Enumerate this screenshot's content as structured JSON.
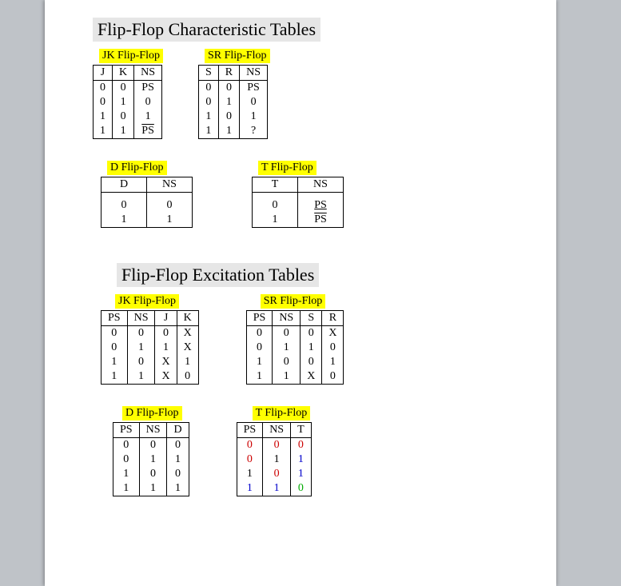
{
  "characteristic": {
    "title": "Flip-Flop Characteristic Tables",
    "jk": {
      "label": "JK Flip-Flop",
      "h": {
        "c0": "J",
        "c1": "K",
        "c2": "NS"
      },
      "r": [
        {
          "c0": "0",
          "c1": "0",
          "c2": "PS"
        },
        {
          "c0": "0",
          "c1": "1",
          "c2": "0"
        },
        {
          "c0": "1",
          "c1": "0",
          "c2": "1"
        },
        {
          "c0": "1",
          "c1": "1",
          "c2": "PS"
        }
      ]
    },
    "sr": {
      "label": "SR Flip-Flop",
      "h": {
        "c0": "S",
        "c1": "R",
        "c2": "NS"
      },
      "r": [
        {
          "c0": "0",
          "c1": "0",
          "c2": "PS"
        },
        {
          "c0": "0",
          "c1": "1",
          "c2": "0"
        },
        {
          "c0": "1",
          "c1": "0",
          "c2": "1"
        },
        {
          "c0": "1",
          "c1": "1",
          "c2": "?"
        }
      ]
    },
    "d": {
      "label": "D Flip-Flop",
      "h": {
        "c0": "D",
        "c1": "NS"
      },
      "r": [
        {
          "c0": "0",
          "c1": "0"
        },
        {
          "c0": "1",
          "c1": "1"
        }
      ]
    },
    "t": {
      "label": "T Flip-Flop",
      "h": {
        "c0": "T",
        "c1": "NS"
      },
      "r": [
        {
          "c0": "0",
          "c1": "PS"
        },
        {
          "c0": "1",
          "c1": "PS"
        }
      ]
    }
  },
  "excitation": {
    "title": "Flip-Flop Excitation Tables",
    "jk": {
      "label": "JK Flip-Flop",
      "h": {
        "c0": "PS",
        "c1": "NS",
        "c2": "J",
        "c3": "K"
      },
      "r": [
        {
          "c0": "0",
          "c1": "0",
          "c2": "0",
          "c3": "X"
        },
        {
          "c0": "0",
          "c1": "1",
          "c2": "1",
          "c3": "X"
        },
        {
          "c0": "1",
          "c1": "0",
          "c2": "X",
          "c3": "1"
        },
        {
          "c0": "1",
          "c1": "1",
          "c2": "X",
          "c3": "0"
        }
      ]
    },
    "sr": {
      "label": "SR Flip-Flop",
      "h": {
        "c0": "PS",
        "c1": "NS",
        "c2": "S",
        "c3": "R"
      },
      "r": [
        {
          "c0": "0",
          "c1": "0",
          "c2": "0",
          "c3": "X"
        },
        {
          "c0": "0",
          "c1": "1",
          "c2": "1",
          "c3": "0"
        },
        {
          "c0": "1",
          "c1": "0",
          "c2": "0",
          "c3": "1"
        },
        {
          "c0": "1",
          "c1": "1",
          "c2": "X",
          "c3": "0"
        }
      ]
    },
    "d": {
      "label": "D Flip-Flop",
      "h": {
        "c0": "PS",
        "c1": "NS",
        "c2": "D"
      },
      "r": [
        {
          "c0": "0",
          "c1": "0",
          "c2": "0"
        },
        {
          "c0": "0",
          "c1": "1",
          "c2": "1"
        },
        {
          "c0": "1",
          "c1": "0",
          "c2": "0"
        },
        {
          "c0": "1",
          "c1": "1",
          "c2": "1"
        }
      ]
    },
    "t": {
      "label": "T Flip-Flop",
      "h": {
        "c0": "PS",
        "c1": "NS",
        "c2": "T"
      },
      "r": [
        {
          "c0": "0",
          "c1": "0",
          "c2": "0"
        },
        {
          "c0": "0",
          "c1": "1",
          "c2": "1"
        },
        {
          "c0": "1",
          "c1": "0",
          "c2": "1"
        },
        {
          "c0": "1",
          "c1": "1",
          "c2": "0"
        }
      ]
    }
  }
}
